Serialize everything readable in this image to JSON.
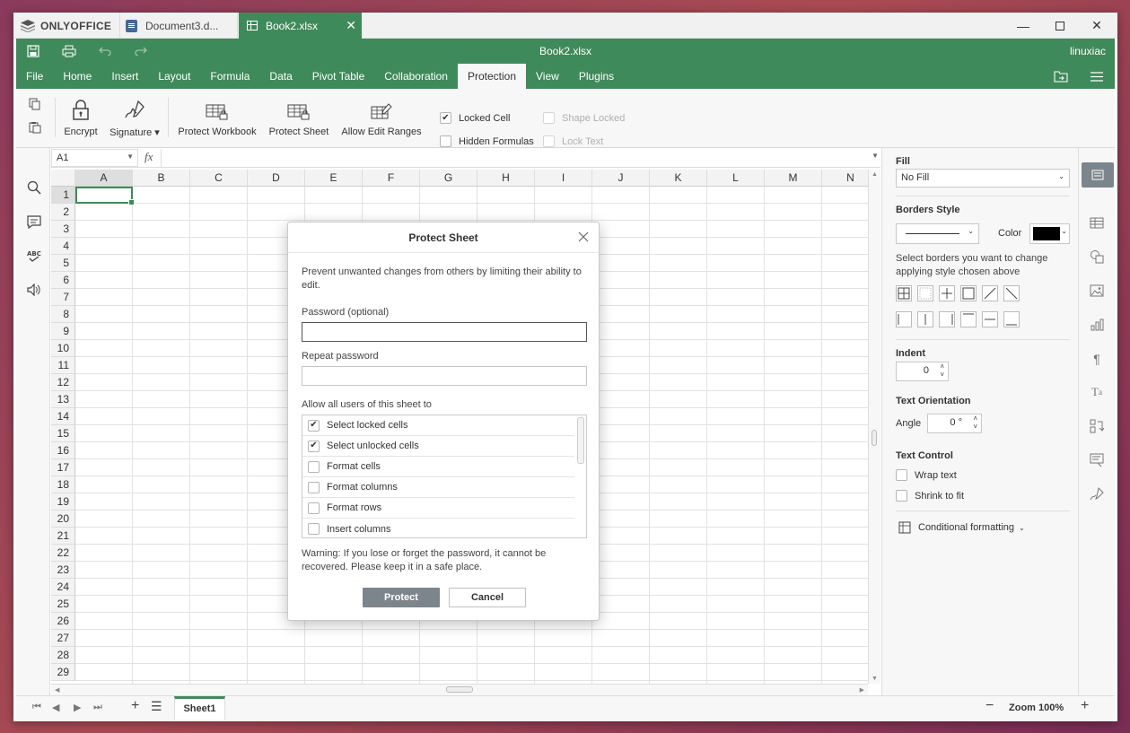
{
  "tabs": {
    "logo": "ONLYOFFICE",
    "doc": "Document3.d...",
    "book": "Book2.xlsx"
  },
  "header": {
    "title": "Book2.xlsx",
    "user": "linuxiac"
  },
  "menus": [
    "File",
    "Home",
    "Insert",
    "Layout",
    "Formula",
    "Data",
    "Pivot Table",
    "Collaboration",
    "Protection",
    "View",
    "Plugins"
  ],
  "active_menu": "Protection",
  "ribbon": {
    "encrypt": "Encrypt",
    "signature": "Signature",
    "protect_workbook": "Protect Workbook",
    "protect_sheet": "Protect Sheet",
    "allow_edit": "Allow Edit Ranges",
    "locked_cell": "Locked Cell",
    "hidden_formulas": "Hidden Formulas",
    "shape_locked": "Shape Locked",
    "lock_text": "Lock Text"
  },
  "formula": {
    "cell_ref": "A1",
    "fx": "fx",
    "value": ""
  },
  "columns": [
    "A",
    "B",
    "C",
    "D",
    "E",
    "F",
    "G",
    "H",
    "I",
    "J",
    "K",
    "L",
    "M",
    "N"
  ],
  "rows": [
    "1",
    "2",
    "3",
    "4",
    "5",
    "6",
    "7",
    "8",
    "9",
    "10",
    "11",
    "12",
    "13",
    "14",
    "15",
    "16",
    "17",
    "18",
    "19",
    "20",
    "21",
    "22",
    "23",
    "24",
    "25",
    "26",
    "27",
    "28",
    "29"
  ],
  "sheet": {
    "tab": "Sheet1",
    "zoom": "Zoom 100%"
  },
  "panel": {
    "fill_label": "Fill",
    "fill_value": "No Fill",
    "borders_label": "Borders Style",
    "color_label": "Color",
    "borders_hint": "Select borders you want to change applying style chosen above",
    "indent_label": "Indent",
    "indent_value": "0",
    "orientation_label": "Text Orientation",
    "angle_label": "Angle",
    "angle_value": "0 °",
    "control_label": "Text Control",
    "wrap": "Wrap text",
    "shrink": "Shrink to fit",
    "cond": "Conditional formatting"
  },
  "dialog": {
    "title": "Protect Sheet",
    "desc": "Prevent unwanted changes from others by limiting their ability to edit.",
    "password_label": "Password (optional)",
    "password_value": "",
    "repeat_label": "Repeat password",
    "repeat_value": "",
    "allow_label": "Allow all users of this sheet to",
    "permissions": [
      {
        "label": "Select locked cells",
        "checked": true
      },
      {
        "label": "Select unlocked cells",
        "checked": true
      },
      {
        "label": "Format cells",
        "checked": false
      },
      {
        "label": "Format columns",
        "checked": false
      },
      {
        "label": "Format rows",
        "checked": false
      },
      {
        "label": "Insert columns",
        "checked": false
      }
    ],
    "warning": "Warning: If you lose or forget the password, it cannot be recovered. Please keep it in a safe place.",
    "protect": "Protect",
    "cancel": "Cancel"
  },
  "colors": {
    "accent": "#3f8a5a",
    "protect_btn": "#7d858c"
  }
}
